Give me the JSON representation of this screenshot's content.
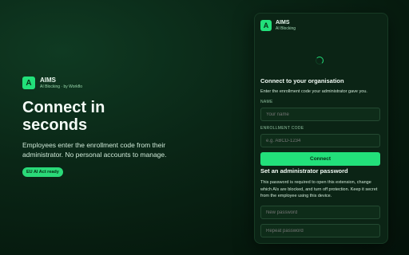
{
  "hero": {
    "logo_letter": "A",
    "brand_name": "AIMS",
    "brand_sub": "AI Blocking · by Workflo",
    "title": "Connect in seconds",
    "description": "Employees enter the enrollment code from their administrator. No personal accounts to manage.",
    "badge": "EU AI Act ready"
  },
  "panel": {
    "logo_letter": "A",
    "brand_name": "AIMS",
    "brand_sub": "AI Blocking",
    "connect": {
      "title": "Connect to your organisation",
      "subtitle": "Enter the enrollment code your administrator gave you.",
      "name_label": "NAME",
      "name_placeholder": "Your name",
      "code_label": "ENROLLMENT CODE",
      "code_placeholder": "e.g. ABCD-1234",
      "button": "Connect"
    },
    "admin": {
      "title": "Set an administrator password",
      "text": "This password is required to open this extension, change which AIs are blocked, and turn off protection. Keep it secret from the employee using this device.",
      "new_placeholder": "New password",
      "repeat_placeholder": "Repeat password"
    }
  },
  "colors": {
    "accent": "#22e07a",
    "background": "#0a2616",
    "panel": "#0b2415"
  },
  "icons": {
    "spinner": "loading-spinner-icon"
  }
}
